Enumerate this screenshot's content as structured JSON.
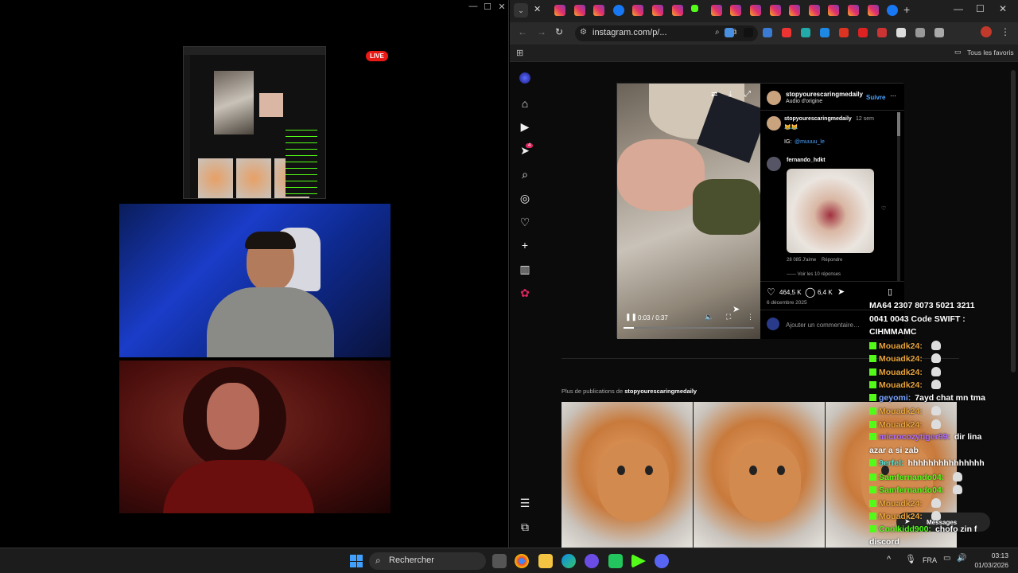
{
  "stream": {
    "live_badge": "LIVE"
  },
  "browser": {
    "url": "instagram.com/p/...",
    "bookmarks_label": "Tous les favoris",
    "notification_count": "4",
    "tab_count": 18
  },
  "post": {
    "username": "stopyourescaringmedaily",
    "follow": "Suivre",
    "audio": "Audio d'origine",
    "caption_user": "stopyourescaringmedaily",
    "caption_time": "12 sem",
    "caption_emojis": "😹😹",
    "ig_prefix": "IG:",
    "ig_handle": "@muuuu_le",
    "commenter": "fernando_hdkt",
    "comment_likes": "28 085 J'aime",
    "reply": "Répondre",
    "view_replies": "Voir les 10 réponses",
    "likes": "464,5 K",
    "comments": "6,4 K",
    "date": "6 décembre 2025",
    "add_comment": "Ajouter un commentaire…",
    "video_time": "0:03 / 0:37",
    "video_progress": 0.08
  },
  "more": {
    "prefix": "Plus de publications de ",
    "user": "stopyourescaringmedaily"
  },
  "messages_label": "Messages",
  "chat": [
    {
      "user": "",
      "text": "MA64 2307 8073 5021 3211",
      "color": "#ffffff"
    },
    {
      "user": "",
      "text": "0041 0043 Code SWIFT :",
      "color": "#ffffff"
    },
    {
      "user": "",
      "text": "CIHMMAMC",
      "color": "#ffffff"
    },
    {
      "user": "Mouadk24:",
      "text": "",
      "color": "#e8a33a"
    },
    {
      "user": "Mouadk24:",
      "text": "",
      "color": "#e8a33a"
    },
    {
      "user": "Mouadk24:",
      "text": "",
      "color": "#e8a33a"
    },
    {
      "user": "Mouadk24:",
      "text": "",
      "color": "#e8a33a"
    },
    {
      "user": "geyomi:",
      "text": "7ayd chat mn tma",
      "color": "#7aa6ff"
    },
    {
      "user": "Mouadk24:",
      "text": "",
      "color": "#e8a33a"
    },
    {
      "user": "Mouadk24:",
      "text": "",
      "color": "#e8a33a"
    },
    {
      "user": "microcozytiger99:",
      "text": "dir lina",
      "color": "#b06bff"
    },
    {
      "user": "",
      "text": "azar a si zab",
      "color": "#ffffff"
    },
    {
      "user": "9erfel:",
      "text": "hhhhhhhhhhhhhhh",
      "color": "#55e0d0"
    },
    {
      "user": "Samfernando04:",
      "text": "",
      "color": "#53fc18"
    },
    {
      "user": "Samfernando04:",
      "text": "",
      "color": "#53fc18"
    },
    {
      "user": "Mouadk24:",
      "text": "",
      "color": "#e8a33a"
    },
    {
      "user": "Mouadk24:",
      "text": "",
      "color": "#e8a33a"
    },
    {
      "user": "Coolkidd900:",
      "text": "chofo zin f",
      "color": "#53fc18"
    },
    {
      "user": "",
      "text": "discord",
      "color": "#ffffff"
    }
  ],
  "taskbar": {
    "search_placeholder": "Rechercher",
    "lang": "FRA",
    "time": "03:13",
    "date": "01/03/2026"
  }
}
